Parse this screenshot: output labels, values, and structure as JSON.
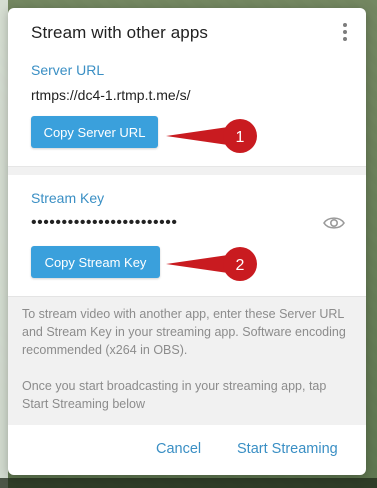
{
  "dialog": {
    "title": "Stream with other apps",
    "server": {
      "label": "Server URL",
      "value": "rtmps://dc4-1.rtmp.t.me/s/",
      "copy_button": "Copy Server URL"
    },
    "key": {
      "label": "Stream Key",
      "value": "••••••••••••••••••••••••",
      "copy_button": "Copy Stream Key"
    },
    "info": {
      "paragraph1": "To stream video with another app, enter these Server URL and Stream Key in your streaming app. Software encoding recommended (x264 in OBS).",
      "paragraph2": "Once you start broadcasting in your streaming app, tap Start Streaming below"
    },
    "actions": {
      "cancel": "Cancel",
      "start": "Start Streaming"
    }
  },
  "annotations": [
    {
      "number": "1"
    },
    {
      "number": "2"
    }
  ],
  "icons": {
    "more": "more-vertical-icon",
    "eye": "eye-icon"
  },
  "colors": {
    "accent": "#3a8fc4",
    "button": "#3aa0dc",
    "annotation": "#c91b20"
  }
}
